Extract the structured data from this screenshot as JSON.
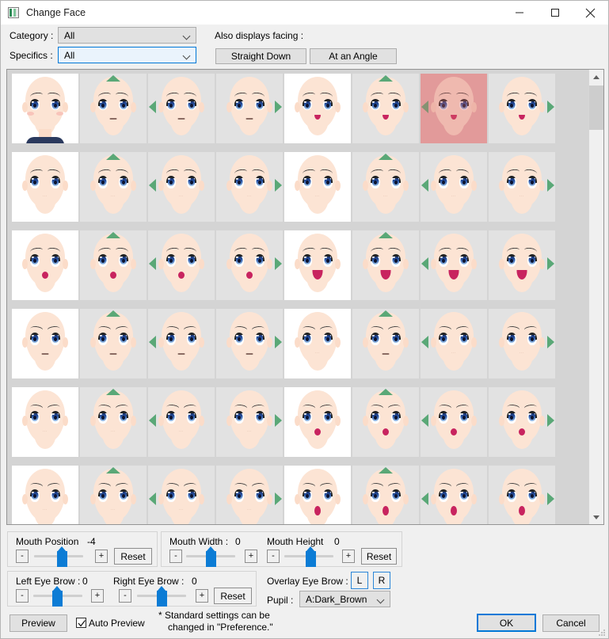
{
  "window": {
    "title": "Change Face",
    "icon": "app-icon",
    "minimize": "minimize-icon",
    "maximize": "maximize-icon",
    "close": "close-icon"
  },
  "filters": {
    "category_label": "Category :",
    "category_value": "All",
    "specifics_label": "Specifics :",
    "specifics_value": "All",
    "facing_label": "Also displays facing :",
    "straight_down": "Straight Down",
    "at_an_angle": "At an Angle"
  },
  "grid": {
    "columns": 8,
    "rows": [
      {
        "cells": [
          {
            "bg": "white",
            "marker": "none",
            "mouth": "none",
            "brow": "soft",
            "eye": "normal",
            "base": true
          },
          {
            "bg": "gray",
            "marker": "up",
            "mouth": "line",
            "brow": "soft",
            "eye": "normal"
          },
          {
            "bg": "gray",
            "marker": "left",
            "mouth": "line",
            "brow": "soft",
            "eye": "normal"
          },
          {
            "bg": "gray",
            "marker": "right",
            "mouth": "line",
            "brow": "soft",
            "eye": "normal"
          },
          {
            "bg": "white",
            "marker": "none",
            "mouth": "small",
            "brow": "soft",
            "eye": "normal"
          },
          {
            "bg": "gray",
            "marker": "up",
            "mouth": "small",
            "brow": "soft",
            "eye": "normal"
          },
          {
            "bg": "selected",
            "marker": "left",
            "mouth": "small",
            "brow": "soft",
            "eye": "normal"
          },
          {
            "bg": "gray",
            "marker": "right",
            "mouth": "small",
            "brow": "soft",
            "eye": "normal"
          }
        ]
      },
      {
        "cells": [
          {
            "bg": "white",
            "marker": "none",
            "mouth": "dots",
            "brow": "arched",
            "eye": "tall"
          },
          {
            "bg": "gray",
            "marker": "up",
            "mouth": "dots",
            "brow": "arched",
            "eye": "tall"
          },
          {
            "bg": "gray",
            "marker": "left",
            "mouth": "dots",
            "brow": "arched",
            "eye": "tall"
          },
          {
            "bg": "gray",
            "marker": "right",
            "mouth": "dots",
            "brow": "arched",
            "eye": "tall"
          },
          {
            "bg": "white",
            "marker": "none",
            "mouth": "dots",
            "brow": "arched",
            "eye": "tall"
          },
          {
            "bg": "gray",
            "marker": "up",
            "mouth": "dots",
            "brow": "arched",
            "eye": "tall"
          },
          {
            "bg": "gray",
            "marker": "left",
            "mouth": "dots",
            "brow": "arched",
            "eye": "tall"
          },
          {
            "bg": "gray",
            "marker": "right",
            "mouth": "dots",
            "brow": "arched",
            "eye": "tall"
          }
        ]
      },
      {
        "cells": [
          {
            "bg": "white",
            "marker": "none",
            "mouth": "dot",
            "brow": "arched",
            "eye": "tall"
          },
          {
            "bg": "gray",
            "marker": "up",
            "mouth": "dot",
            "brow": "arched",
            "eye": "tall"
          },
          {
            "bg": "gray",
            "marker": "left",
            "mouth": "dot",
            "brow": "arched",
            "eye": "tall"
          },
          {
            "bg": "gray",
            "marker": "right",
            "mouth": "dot",
            "brow": "arched",
            "eye": "tall"
          },
          {
            "bg": "white",
            "marker": "none",
            "mouth": "open",
            "brow": "arched",
            "eye": "tall"
          },
          {
            "bg": "gray",
            "marker": "up",
            "mouth": "open",
            "brow": "arched",
            "eye": "tall"
          },
          {
            "bg": "gray",
            "marker": "left",
            "mouth": "open",
            "brow": "arched",
            "eye": "tall"
          },
          {
            "bg": "gray",
            "marker": "right",
            "mouth": "open",
            "brow": "arched",
            "eye": "tall"
          }
        ]
      },
      {
        "cells": [
          {
            "bg": "white",
            "marker": "none",
            "mouth": "line",
            "brow": "angry",
            "eye": "tall"
          },
          {
            "bg": "gray",
            "marker": "up",
            "mouth": "line",
            "brow": "angry",
            "eye": "tall"
          },
          {
            "bg": "gray",
            "marker": "left",
            "mouth": "line",
            "brow": "angry",
            "eye": "tall"
          },
          {
            "bg": "gray",
            "marker": "right",
            "mouth": "line",
            "brow": "angry",
            "eye": "tall"
          },
          {
            "bg": "white",
            "marker": "none",
            "mouth": "dots",
            "brow": "angry",
            "eye": "tall"
          },
          {
            "bg": "gray",
            "marker": "up",
            "mouth": "line",
            "brow": "angry",
            "eye": "tall"
          },
          {
            "bg": "gray",
            "marker": "left",
            "mouth": "dots",
            "brow": "angry",
            "eye": "tall"
          },
          {
            "bg": "gray",
            "marker": "right",
            "mouth": "dots",
            "brow": "angry",
            "eye": "tall"
          }
        ]
      },
      {
        "cells": [
          {
            "bg": "white",
            "marker": "none",
            "mouth": "dots",
            "brow": "angry",
            "eye": "tall"
          },
          {
            "bg": "gray",
            "marker": "up",
            "mouth": "dots",
            "brow": "angry",
            "eye": "tall"
          },
          {
            "bg": "gray",
            "marker": "left",
            "mouth": "dots",
            "brow": "angry",
            "eye": "tall"
          },
          {
            "bg": "gray",
            "marker": "right",
            "mouth": "dots",
            "brow": "angry",
            "eye": "tall"
          },
          {
            "bg": "white",
            "marker": "none",
            "mouth": "dot",
            "brow": "angry",
            "eye": "tall"
          },
          {
            "bg": "gray",
            "marker": "up",
            "mouth": "dot",
            "brow": "angry",
            "eye": "tall"
          },
          {
            "bg": "gray",
            "marker": "left",
            "mouth": "dot",
            "brow": "angry",
            "eye": "tall"
          },
          {
            "bg": "gray",
            "marker": "right",
            "mouth": "dot",
            "brow": "angry",
            "eye": "tall"
          }
        ]
      },
      {
        "cells": [
          {
            "bg": "white",
            "marker": "none",
            "mouth": "dots",
            "brow": "angry",
            "eye": "tall"
          },
          {
            "bg": "gray",
            "marker": "up",
            "mouth": "dots",
            "brow": "angry",
            "eye": "tall"
          },
          {
            "bg": "gray",
            "marker": "left",
            "mouth": "dots",
            "brow": "angry",
            "eye": "tall"
          },
          {
            "bg": "gray",
            "marker": "right",
            "mouth": "dots",
            "brow": "angry",
            "eye": "tall"
          },
          {
            "bg": "white",
            "marker": "none",
            "mouth": "oval",
            "brow": "angry",
            "eye": "tall"
          },
          {
            "bg": "gray",
            "marker": "up",
            "mouth": "oval",
            "brow": "angry",
            "eye": "tall"
          },
          {
            "bg": "gray",
            "marker": "left",
            "mouth": "oval",
            "brow": "angry",
            "eye": "tall"
          },
          {
            "bg": "gray",
            "marker": "right",
            "mouth": "oval",
            "brow": "angry",
            "eye": "tall"
          }
        ]
      }
    ],
    "scrollbar": {
      "up": "scroll-up-icon",
      "down": "scroll-down-icon"
    }
  },
  "sliders": {
    "mouth_position": {
      "label": "Mouth Position",
      "value": "-4",
      "minus": "-",
      "plus": "+",
      "reset": "Reset"
    },
    "mouth_width": {
      "label": "Mouth Width :",
      "value": "0",
      "minus": "-",
      "plus": "+"
    },
    "mouth_height": {
      "label": "Mouth Height",
      "value": "0",
      "minus": "-",
      "plus": "+",
      "reset": "Reset"
    },
    "left_eyebrow": {
      "label": "Left Eye Brow :",
      "value": "0",
      "minus": "-",
      "plus": "+"
    },
    "right_eyebrow": {
      "label": "Right Eye Brow :",
      "value": "0",
      "minus": "-",
      "plus": "+",
      "reset": "Reset"
    }
  },
  "overlay": {
    "label": "Overlay Eye Brow :",
    "left": "L",
    "right": "R",
    "pupil_label": "Pupil :",
    "pupil_value": "A:Dark_Brown"
  },
  "footer": {
    "preview": "Preview",
    "auto_preview": "Auto Preview",
    "hint_line1": "* Standard settings can be",
    "hint_line2": "changed in \"Preference.\"",
    "ok": "OK",
    "cancel": "Cancel"
  },
  "colors": {
    "accent": "#0078d7",
    "slider": "#0c7cd5",
    "marker": "#5aa877",
    "selection": "#e9b4b4",
    "skin": "#fce4d4",
    "mouth": "#c8245f"
  }
}
